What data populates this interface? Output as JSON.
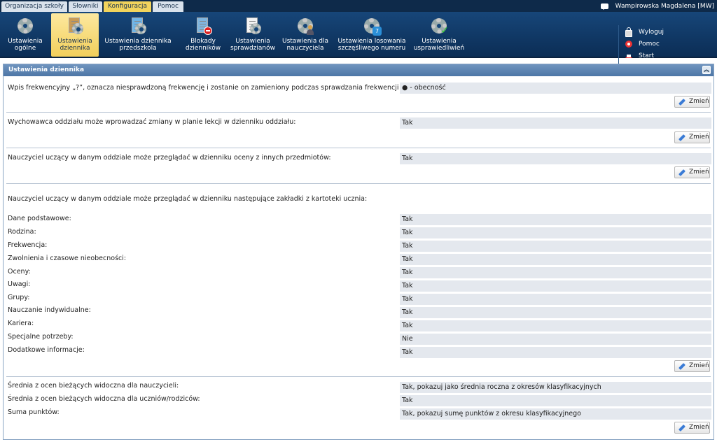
{
  "top_menu": [
    "Organizacja szkoły",
    "Słowniki",
    "Konfiguracja",
    "Pomoc"
  ],
  "user": {
    "name": "Wampirowska Magdalena [MW]"
  },
  "toolbar": [
    {
      "line1": "Ustawienia",
      "line2": "ogólne",
      "icon": "gear-icon"
    },
    {
      "line1": "Ustawienia",
      "line2": "dziennika",
      "icon": "journal-settings-icon"
    },
    {
      "line1": "Ustawienia dziennika",
      "line2": "przedszkola",
      "icon": "preschool-journal-icon"
    },
    {
      "line1": "Blokady",
      "line2": "dzienników",
      "icon": "journal-lock-icon"
    },
    {
      "line1": "Ustawienia",
      "line2": "sprawdzianów",
      "icon": "tests-settings-icon"
    },
    {
      "line1": "Ustawienia dla",
      "line2": "nauczyciela",
      "icon": "teacher-settings-icon"
    },
    {
      "line1": "Ustawienia losowania",
      "line2": "szczęśliwego numeru",
      "icon": "lucky-number-icon"
    },
    {
      "line1": "Ustawienia",
      "line2": "usprawiedliwień",
      "icon": "excuses-settings-icon"
    }
  ],
  "side_links": {
    "logout": "Wyloguj",
    "help": "Pomoc",
    "start": "Start"
  },
  "panel": {
    "title": "Ustawienia dziennika",
    "change_label": "Zmień",
    "s1": {
      "label": "Wpis frekwencyjny „?”, oznacza niesprawdzoną frekwencję i zostanie on zamieniony podczas sprawdzania frekwencji na:",
      "value": "● - obecność"
    },
    "s2": {
      "label": "Wychowawca oddziału może wprowadzać zmiany w planie lekcji w dzienniku oddziału:",
      "value": "Tak"
    },
    "s3": {
      "label": "Nauczyciel uczący w danym oddziale może przeglądać w dzienniku oceny z innych przedmiotów:",
      "value": "Tak"
    },
    "s4": {
      "intro": "Nauczyciel uczący w danym oddziale może przeglądać w dzienniku następujące zakładki z kartoteki ucznia:",
      "rows": [
        {
          "label": "Dane podstawowe:",
          "value": "Tak"
        },
        {
          "label": "Rodzina:",
          "value": "Tak"
        },
        {
          "label": "Frekwencja:",
          "value": "Tak"
        },
        {
          "label": "Zwolnienia i czasowe nieobecności:",
          "value": "Tak"
        },
        {
          "label": "Oceny:",
          "value": "Tak"
        },
        {
          "label": "Uwagi:",
          "value": "Tak"
        },
        {
          "label": "Grupy:",
          "value": "Tak"
        },
        {
          "label": "Nauczanie indywidualne:",
          "value": "Tak"
        },
        {
          "label": "Kariera:",
          "value": "Tak"
        },
        {
          "label": "Specjalne potrzeby:",
          "value": "Nie"
        },
        {
          "label": "Dodatkowe informacje:",
          "value": "Tak"
        }
      ]
    },
    "s5": {
      "rows": [
        {
          "label": "Średnia z ocen bieżących widoczna dla nauczycieli:",
          "value": "Tak, pokazuj jako średnia roczna z okresów klasyfikacyjnych"
        },
        {
          "label": "Średnia z ocen bieżących widoczna dla uczniów/rodziców:",
          "value": "Tak"
        },
        {
          "label": "Suma punktów:",
          "value": "Tak, pokazuj sumę punktów z okresu klasyfikacyjnego"
        }
      ]
    }
  }
}
